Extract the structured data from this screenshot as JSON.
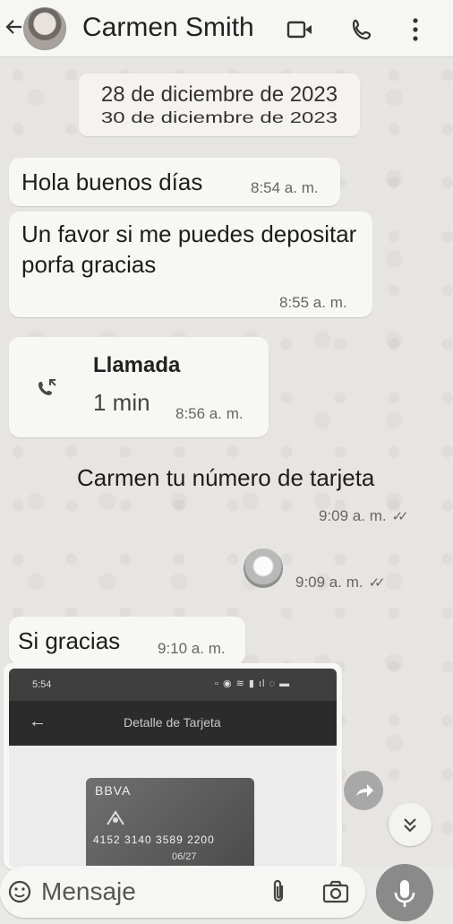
{
  "header": {
    "contact_name": "Carmen Smith",
    "icons": [
      "back-arrow-icon",
      "video-call-icon",
      "phone-icon",
      "more-options-icon"
    ]
  },
  "date_pill": {
    "date": "28 de diciembre de 2023",
    "ghost_date": "30 de diciembre de 2023"
  },
  "messages": [
    {
      "direction": "in",
      "text": "Hola buenos días",
      "time": "8:54 a. m."
    },
    {
      "direction": "in",
      "text": "Un favor si me puedes depositar porfa gracias",
      "time": "8:55 a. m."
    },
    {
      "direction": "in",
      "type": "call",
      "title": "Llamada",
      "duration": "1 min",
      "time": "8:56 a. m."
    },
    {
      "direction": "out",
      "text": "Carmen tu número de tarjeta",
      "time": "9:09 a. m.",
      "status": "read"
    },
    {
      "direction": "out",
      "type": "emoji",
      "time": "9:09 a. m.",
      "status": "read"
    },
    {
      "direction": "in",
      "text": "Si gracias",
      "time": "9:10 a. m."
    },
    {
      "direction": "in",
      "type": "image",
      "screenshot": {
        "clock": "5:54",
        "title": "Detalle de Tarjeta",
        "card_brand": "BBVA",
        "card_number": "4152 3140 3589 2200",
        "card_expiry": "06/27"
      }
    }
  ],
  "input_bar": {
    "placeholder": "Mensaje"
  },
  "colors": {
    "header_bg": "#f6f6f4",
    "bubble_bg": "#f7f7f5",
    "wallpaper": "#e6e5e2",
    "mic_button": "#8a8a8a"
  }
}
